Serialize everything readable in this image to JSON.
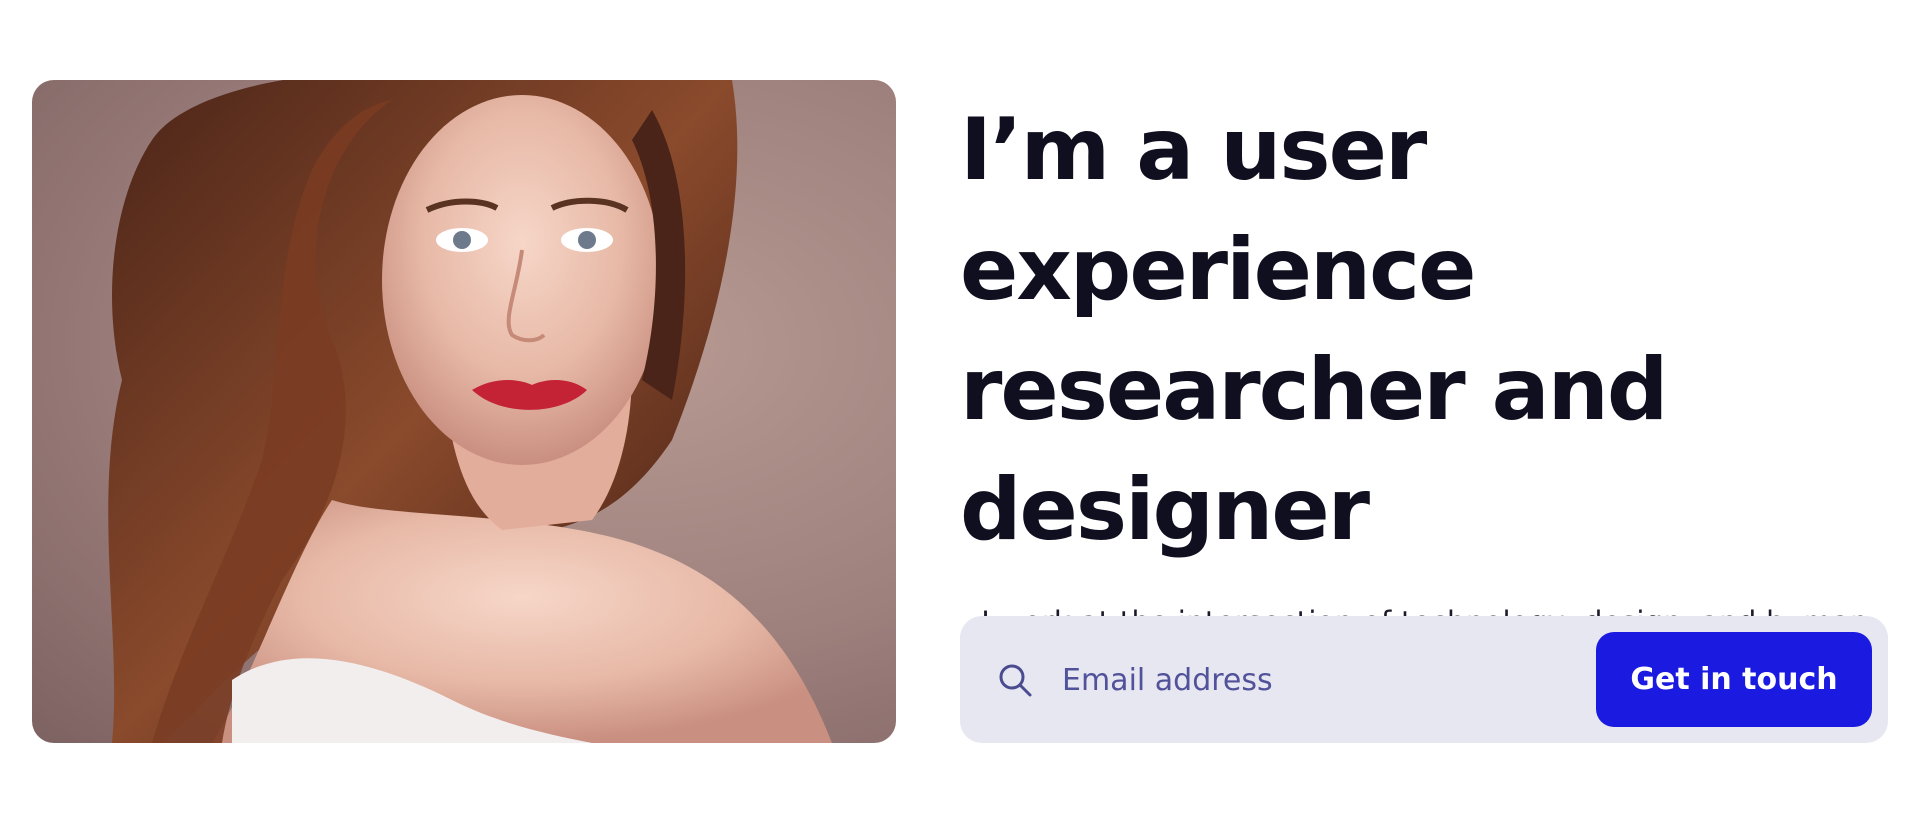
{
  "hero": {
    "headline": "I’m a user experience\n researcher and\ndesigner",
    "subtitle": "I work at the intersection of technology, design, and human behavior to create intuitive, human-centered experiences.",
    "email_placeholder": "Email address",
    "cta_label": "Get in touch"
  },
  "icons": {
    "search": "search-icon"
  },
  "colors": {
    "cta_background": "#1a1ae0",
    "input_background": "#e7e7f2",
    "headline": "#0f0f1f"
  }
}
